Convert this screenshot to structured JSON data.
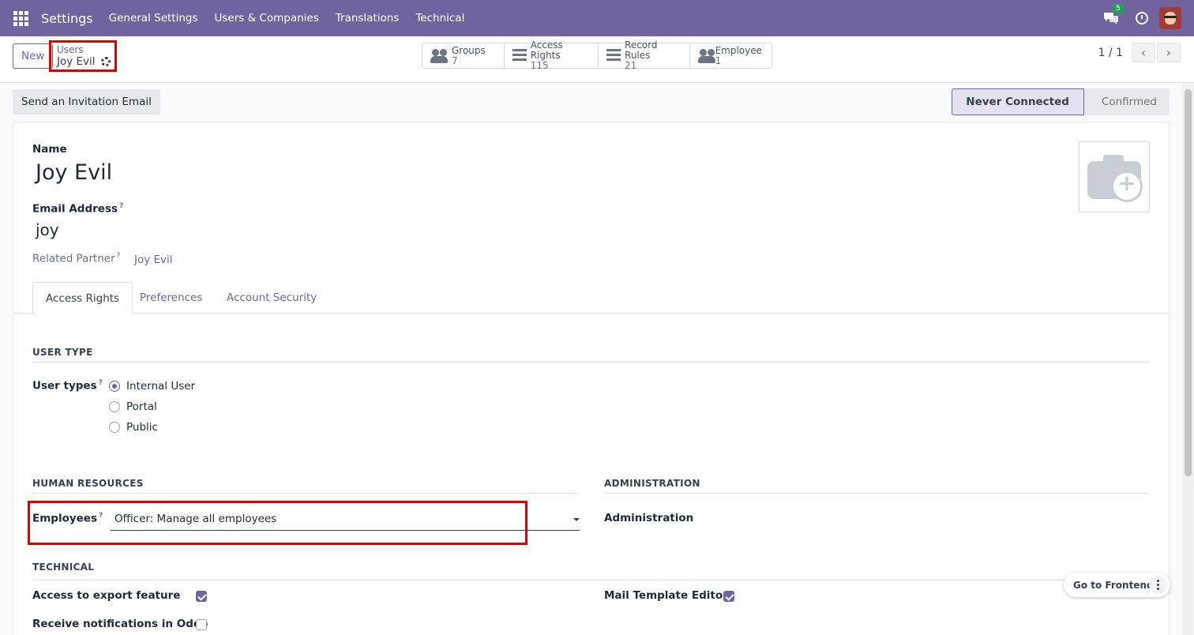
{
  "navbar": {
    "app_name": "Settings",
    "menu": [
      "General Settings",
      "Users & Companies",
      "Translations",
      "Technical"
    ],
    "chat_count": "5",
    "color": "#71639e"
  },
  "control": {
    "new_label": "New",
    "breadcrumb_parent": "Users",
    "breadcrumb_current": "Joy Evil",
    "smart_buttons": [
      {
        "label": "Groups",
        "value": "7",
        "icon": "users-icon"
      },
      {
        "label": "Access Rights",
        "value": "115",
        "icon": "list-icon"
      },
      {
        "label": "Record Rules",
        "value": "21",
        "icon": "list-icon"
      },
      {
        "label": "Employee",
        "value": "1",
        "icon": "users-icon"
      }
    ],
    "pager": "1 / 1"
  },
  "header": {
    "invite_label": "Send an Invitation Email",
    "status_active": "Never Connected",
    "status_next": "Confirmed"
  },
  "form": {
    "name_label": "Name",
    "name_value": "Joy Evil",
    "email_label": "Email Address",
    "email_value": "joy",
    "partner_label": "Related Partner",
    "partner_value": "Joy Evil",
    "help_mark": "?"
  },
  "tabs": [
    "Access Rights",
    "Preferences",
    "Account Security"
  ],
  "access": {
    "user_type_title": "USER TYPE",
    "user_types_label": "User types",
    "user_types": [
      "Internal User",
      "Portal",
      "Public"
    ],
    "selected_user_type": "Internal User",
    "hr_title": "HUMAN RESOURCES",
    "employees_label": "Employees",
    "employees_value": "Officer: Manage all employees",
    "admin_title": "ADMINISTRATION",
    "admin_label": "Administration",
    "technical_title": "TECHNICAL",
    "export_label": "Access to export feature",
    "export_checked": true,
    "notifications_label": "Receive notifications in Odoo",
    "notifications_checked": false,
    "mail_template_label": "Mail Template Editor",
    "mail_template_checked": true
  },
  "floating": {
    "frontend_label": "Go to Frontend"
  }
}
